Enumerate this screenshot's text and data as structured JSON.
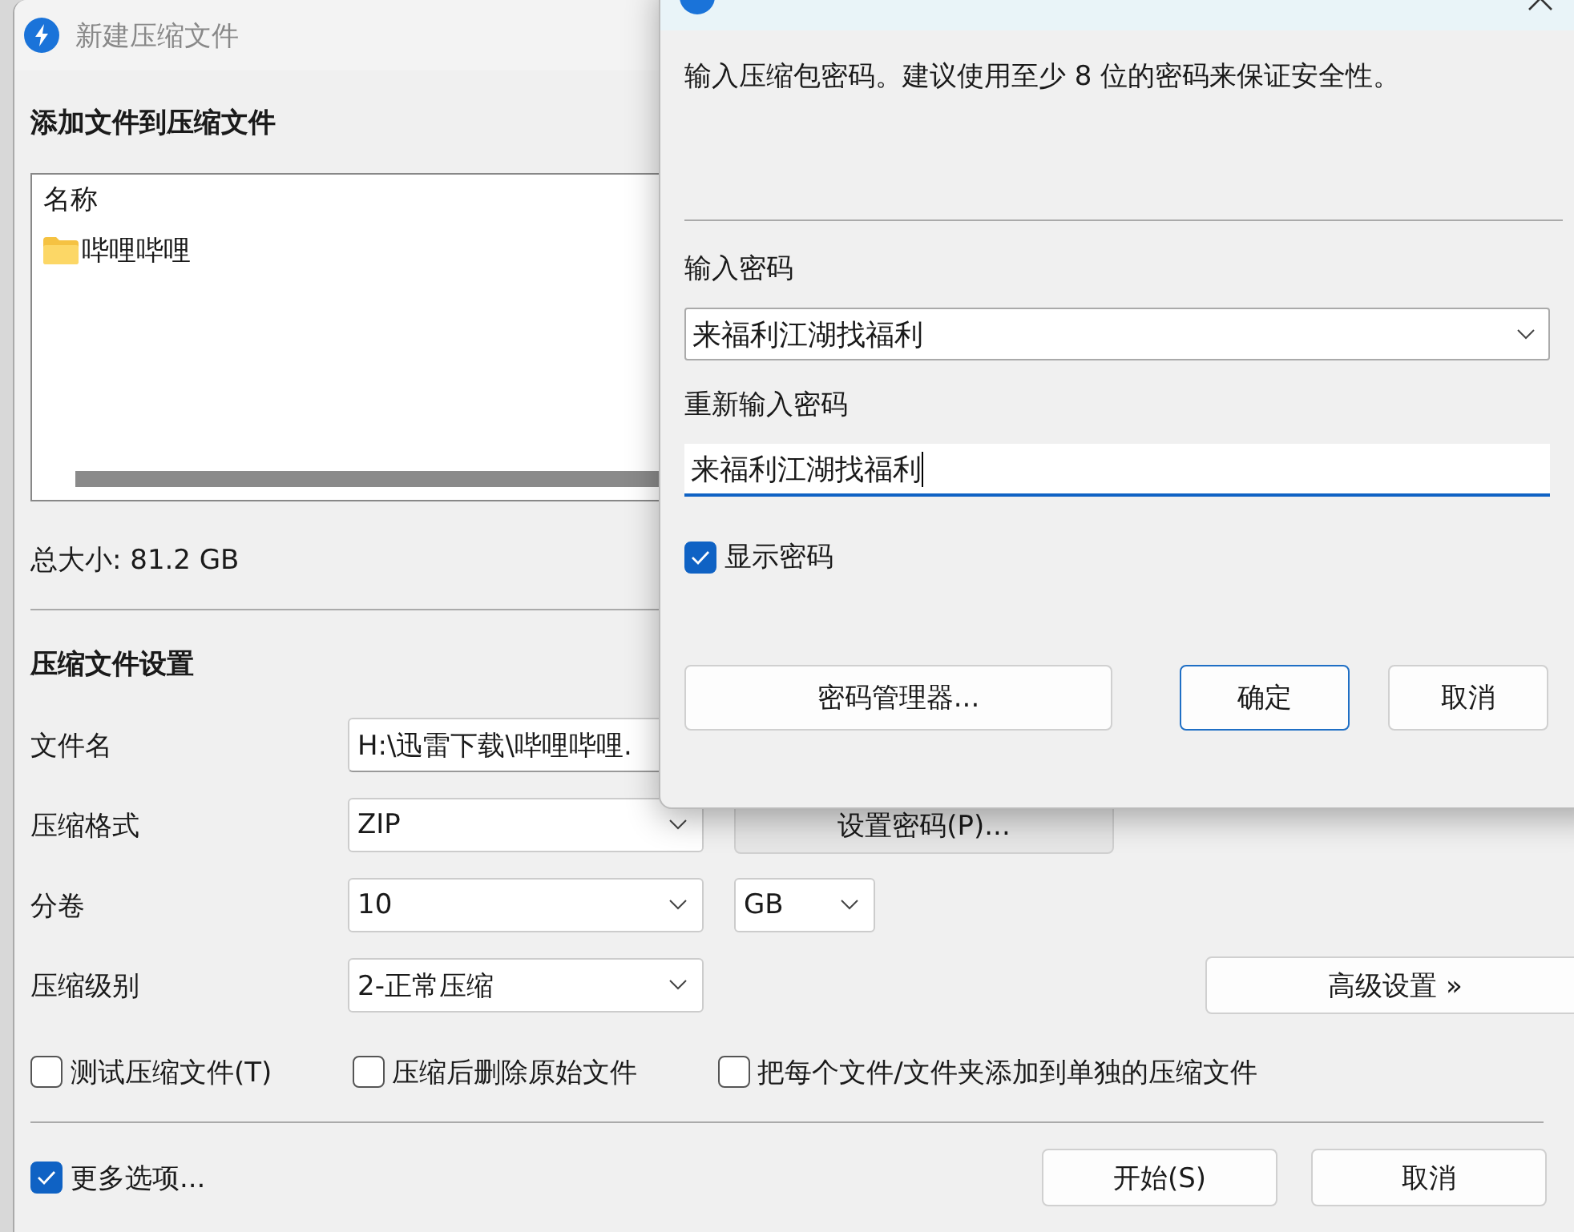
{
  "window": {
    "title": "新建压缩文件"
  },
  "files": {
    "heading": "添加文件到压缩文件",
    "columns": [
      "名称"
    ],
    "rows": [
      {
        "name": "哔哩哔哩",
        "kind": "folder"
      }
    ],
    "total": "总大小: 81.2 GB"
  },
  "settings": {
    "heading": "压缩文件设置",
    "rows": [
      {
        "label": "文件名",
        "field": {
          "kind": "input",
          "value": "H:\\迅雷下载\\哔哩哔哩."
        }
      },
      {
        "label": "压缩格式",
        "field": {
          "kind": "select",
          "value": "ZIP"
        },
        "extra": {
          "kind": "button",
          "label": "设置密码(P)..."
        }
      },
      {
        "label": "分卷",
        "field": {
          "kind": "select",
          "value": "10"
        },
        "extra": {
          "kind": "select",
          "value": "GB"
        }
      },
      {
        "label": "压缩级别",
        "field": {
          "kind": "select",
          "value": "2-正常压缩"
        },
        "extra": {
          "kind": "right_button",
          "label": "高级设置 »"
        }
      }
    ]
  },
  "options": [
    {
      "label": "测试压缩文件(T)",
      "checked": false
    },
    {
      "label": "压缩后删除原始文件",
      "checked": false
    },
    {
      "label": "把每个文件/文件夹添加到单独的压缩文件",
      "checked": false
    }
  ],
  "more_options": {
    "label": "更多选项...",
    "checked": true
  },
  "buttons": [
    {
      "label": "开始(S)"
    },
    {
      "label": "取消"
    }
  ],
  "password_dialog": {
    "description": "输入压缩包密码。建议使用至少 8 位的密码来保证安全性。",
    "fields": [
      {
        "label": "输入密码",
        "kind": "combo",
        "value": "来福利江湖找福利",
        "focused": false
      },
      {
        "label": "重新输入密码",
        "kind": "input",
        "value": "来福利江湖找福利",
        "focused": true
      }
    ],
    "show_password": {
      "label": "显示密码",
      "checked": true
    },
    "buttons": [
      {
        "label": "密码管理器...",
        "default": false
      },
      {
        "label": "确定",
        "default": true
      },
      {
        "label": "取消",
        "default": false
      }
    ]
  }
}
